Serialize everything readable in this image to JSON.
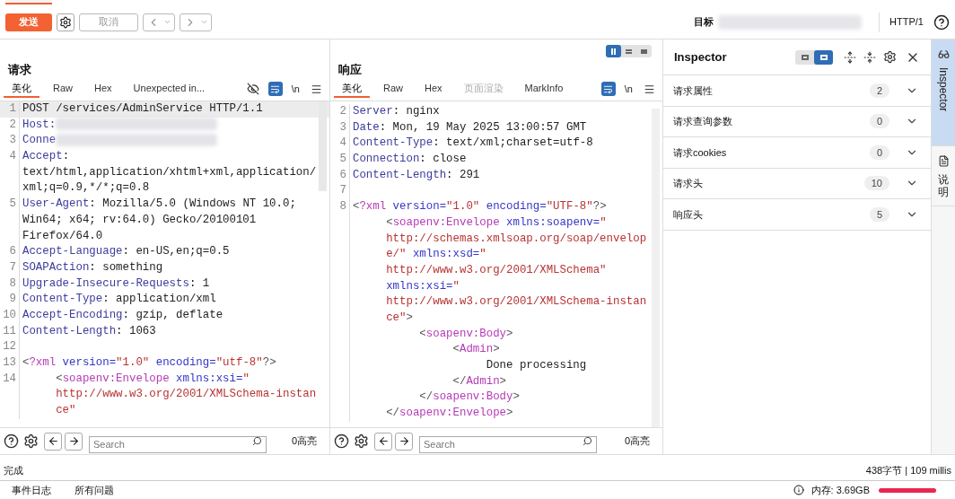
{
  "toolbar": {
    "send": "发送",
    "cancel": {
      "label": "取消",
      "disabled": true
    },
    "target_label": "目标",
    "protocol": "HTTP/1"
  },
  "request": {
    "title": "请求",
    "tabs": [
      {
        "label": "美化",
        "selected": true,
        "disabled": false
      },
      {
        "label": "Raw",
        "selected": false,
        "disabled": false
      },
      {
        "label": "Hex",
        "selected": false,
        "disabled": false
      },
      {
        "label": "Unexpected in...",
        "selected": false,
        "disabled": false
      }
    ],
    "hide_icon": true,
    "wrap_on": true,
    "newline_label": "\\n",
    "rows": [
      {
        "number": "1",
        "current": true,
        "segments": [
          {
            "kind": "plain",
            "text": "POST /services/AdminService HTTP/1.1"
          }
        ]
      },
      {
        "number": "2",
        "segments": [
          {
            "kind": "key",
            "text": "Host:"
          },
          {
            "kind": "redacted"
          }
        ]
      },
      {
        "number": "3",
        "segments": [
          {
            "kind": "key",
            "text": "Conne"
          },
          {
            "kind": "redacted"
          }
        ]
      },
      {
        "number": "4",
        "segments": [
          {
            "kind": "key",
            "text": "Accept"
          },
          {
            "kind": "plain",
            "text": ":"
          }
        ]
      },
      {
        "segments": [
          {
            "kind": "plain",
            "text": "text/html,application/xhtml+xml,application/"
          }
        ]
      },
      {
        "segments": [
          {
            "kind": "plain",
            "text": "xml;q=0.9,*/*;q=0.8"
          }
        ]
      },
      {
        "number": "5",
        "segments": [
          {
            "kind": "key",
            "text": "User-Agent"
          },
          {
            "kind": "plain",
            "text": ": Mozilla/5.0 (Windows NT 10.0;"
          }
        ]
      },
      {
        "segments": [
          {
            "kind": "plain",
            "text": "Win64; x64; rv:64.0) Gecko/20100101"
          }
        ]
      },
      {
        "segments": [
          {
            "kind": "plain",
            "text": "Firefox/64.0"
          }
        ]
      },
      {
        "number": "6",
        "segments": [
          {
            "kind": "key",
            "text": "Accept-Language"
          },
          {
            "kind": "plain",
            "text": ": en-US,en;q=0.5"
          }
        ]
      },
      {
        "number": "7",
        "segments": [
          {
            "kind": "key",
            "text": "SOAPAction"
          },
          {
            "kind": "plain",
            "text": ": something"
          }
        ]
      },
      {
        "number": "8",
        "segments": [
          {
            "kind": "key",
            "text": "Upgrade-Insecure-Requests"
          },
          {
            "kind": "plain",
            "text": ": 1"
          }
        ]
      },
      {
        "number": "9",
        "segments": [
          {
            "kind": "key",
            "text": "Content-Type"
          },
          {
            "kind": "plain",
            "text": ": application/xml"
          }
        ]
      },
      {
        "number": "10",
        "segments": [
          {
            "kind": "key",
            "text": "Accept-Encoding"
          },
          {
            "kind": "plain",
            "text": ": gzip, deflate"
          }
        ]
      },
      {
        "number": "11",
        "segments": [
          {
            "kind": "key",
            "text": "Content-Length"
          },
          {
            "kind": "plain",
            "text": ": 1063"
          }
        ]
      },
      {
        "number": "12",
        "segments": []
      },
      {
        "number": "13",
        "segments": [
          {
            "kind": "punct",
            "text": "<"
          },
          {
            "kind": "tag",
            "text": "?xml"
          },
          {
            "kind": "attr",
            "text": " version="
          },
          {
            "kind": "string",
            "text": "\"1.0\""
          },
          {
            "kind": "attr",
            "text": " encoding="
          },
          {
            "kind": "string",
            "text": "\"utf-8\""
          },
          {
            "kind": "punct",
            "text": "?>"
          }
        ]
      },
      {
        "number": "14",
        "segments": [
          {
            "kind": "punct",
            "text": "     <"
          },
          {
            "kind": "tag",
            "text": "soapenv:Envelope"
          },
          {
            "kind": "attr",
            "text": " xmlns:xsi="
          },
          {
            "kind": "string",
            "text": "\""
          }
        ]
      },
      {
        "segments": [
          {
            "kind": "string",
            "text": "     http://www.w3.org/2001/XMLSchema-instan"
          }
        ]
      },
      {
        "segments": [
          {
            "kind": "string",
            "text": "     ce\""
          }
        ]
      }
    ]
  },
  "response": {
    "title": "响应",
    "layout": [
      {
        "selected": true
      },
      {
        "selected": false
      },
      {
        "selected": false
      }
    ],
    "tabs": [
      {
        "label": "美化",
        "selected": true,
        "disabled": false
      },
      {
        "label": "Raw",
        "selected": false,
        "disabled": false
      },
      {
        "label": "Hex",
        "selected": false,
        "disabled": false
      },
      {
        "label": "页面渲染",
        "selected": false,
        "disabled": true
      },
      {
        "label": "MarkInfo",
        "selected": false,
        "disabled": false
      }
    ],
    "hide_icon": false,
    "wrap_on": true,
    "newline_label": "\\n",
    "rows": [
      {
        "number": "2",
        "segments": [
          {
            "kind": "key",
            "text": "Server"
          },
          {
            "kind": "plain",
            "text": ": nginx"
          }
        ]
      },
      {
        "number": "3",
        "segments": [
          {
            "kind": "key",
            "text": "Date"
          },
          {
            "kind": "plain",
            "text": ": Mon, 19 May 2025 13:00:57 GMT"
          }
        ]
      },
      {
        "number": "4",
        "segments": [
          {
            "kind": "key",
            "text": "Content-Type"
          },
          {
            "kind": "plain",
            "text": ": text/xml;charset=utf-8"
          }
        ]
      },
      {
        "number": "5",
        "segments": [
          {
            "kind": "key",
            "text": "Connection"
          },
          {
            "kind": "plain",
            "text": ": close"
          }
        ]
      },
      {
        "number": "6",
        "segments": [
          {
            "kind": "key",
            "text": "Content-Length"
          },
          {
            "kind": "plain",
            "text": ": 291"
          }
        ]
      },
      {
        "number": "7",
        "segments": []
      },
      {
        "number": "8",
        "segments": [
          {
            "kind": "punct",
            "text": "<"
          },
          {
            "kind": "tag",
            "text": "?xml"
          },
          {
            "kind": "attr",
            "text": " version="
          },
          {
            "kind": "string",
            "text": "\"1.0\""
          },
          {
            "kind": "attr",
            "text": " encoding="
          },
          {
            "kind": "string",
            "text": "\"UTF-8\""
          },
          {
            "kind": "punct",
            "text": "?>"
          }
        ]
      },
      {
        "segments": [
          {
            "kind": "punct",
            "text": "     <"
          },
          {
            "kind": "tag",
            "text": "soapenv:Envelope"
          },
          {
            "kind": "attr",
            "text": " xmlns:soapenv="
          },
          {
            "kind": "string",
            "text": "\""
          }
        ]
      },
      {
        "segments": [
          {
            "kind": "string",
            "text": "     http://schemas.xmlsoap.org/soap/envelop"
          }
        ]
      },
      {
        "segments": [
          {
            "kind": "string",
            "text": "     e/\""
          },
          {
            "kind": "attr",
            "text": " xmlns:xsd="
          },
          {
            "kind": "string",
            "text": "\""
          }
        ]
      },
      {
        "segments": [
          {
            "kind": "string",
            "text": "     http://www.w3.org/2001/XMLSchema\""
          }
        ]
      },
      {
        "segments": [
          {
            "kind": "attr",
            "text": "     xmlns:xsi="
          },
          {
            "kind": "string",
            "text": "\""
          }
        ]
      },
      {
        "segments": [
          {
            "kind": "string",
            "text": "     http://www.w3.org/2001/XMLSchema-instan"
          }
        ]
      },
      {
        "segments": [
          {
            "kind": "string",
            "text": "     ce\""
          },
          {
            "kind": "punct",
            "text": ">"
          }
        ]
      },
      {
        "segments": [
          {
            "kind": "punct",
            "text": "          <"
          },
          {
            "kind": "tag",
            "text": "soapenv:Body"
          },
          {
            "kind": "punct",
            "text": ">"
          }
        ]
      },
      {
        "segments": [
          {
            "kind": "punct",
            "text": "               <"
          },
          {
            "kind": "tag",
            "text": "Admin"
          },
          {
            "kind": "punct",
            "text": ">"
          }
        ]
      },
      {
        "segments": [
          {
            "kind": "plain",
            "text": "                    Done processing"
          }
        ]
      },
      {
        "segments": [
          {
            "kind": "punct",
            "text": "               </"
          },
          {
            "kind": "tag",
            "text": "Admin"
          },
          {
            "kind": "punct",
            "text": ">"
          }
        ]
      },
      {
        "segments": [
          {
            "kind": "punct",
            "text": "          </"
          },
          {
            "kind": "tag",
            "text": "soapenv:Body"
          },
          {
            "kind": "punct",
            "text": ">"
          }
        ]
      },
      {
        "segments": [
          {
            "kind": "punct",
            "text": "     </"
          },
          {
            "kind": "tag",
            "text": "soapenv:Envelope"
          },
          {
            "kind": "punct",
            "text": ">"
          }
        ]
      }
    ]
  },
  "inspector": {
    "title": "Inspector",
    "layout": [
      {
        "selected": false
      },
      {
        "selected": true
      }
    ],
    "sections": [
      {
        "label": "请求属性",
        "count": "2",
        "expanded": false
      },
      {
        "label": "请求查询参数",
        "count": "0",
        "expanded": false
      },
      {
        "label": "请求cookies",
        "count": "0",
        "expanded": false
      },
      {
        "label": "请求头",
        "count": "10",
        "expanded": false
      },
      {
        "label": "响应头",
        "count": "5",
        "expanded": false
      }
    ]
  },
  "side_tabs": [
    {
      "label": "Inspector",
      "kind": "rotated",
      "selected": true
    },
    {
      "label": "说明",
      "kind": "stacked",
      "selected": false
    }
  ],
  "search_bars": [
    {
      "placeholder": "Search",
      "highlights": "0高亮"
    },
    {
      "placeholder": "Search",
      "highlights": "0高亮"
    }
  ],
  "status": {
    "message": "完成",
    "size": "438字节 | 109 millis"
  },
  "footer": {
    "tabs": [
      "事件日志",
      "所有问题"
    ],
    "memory": "内存: 3.69GB"
  }
}
